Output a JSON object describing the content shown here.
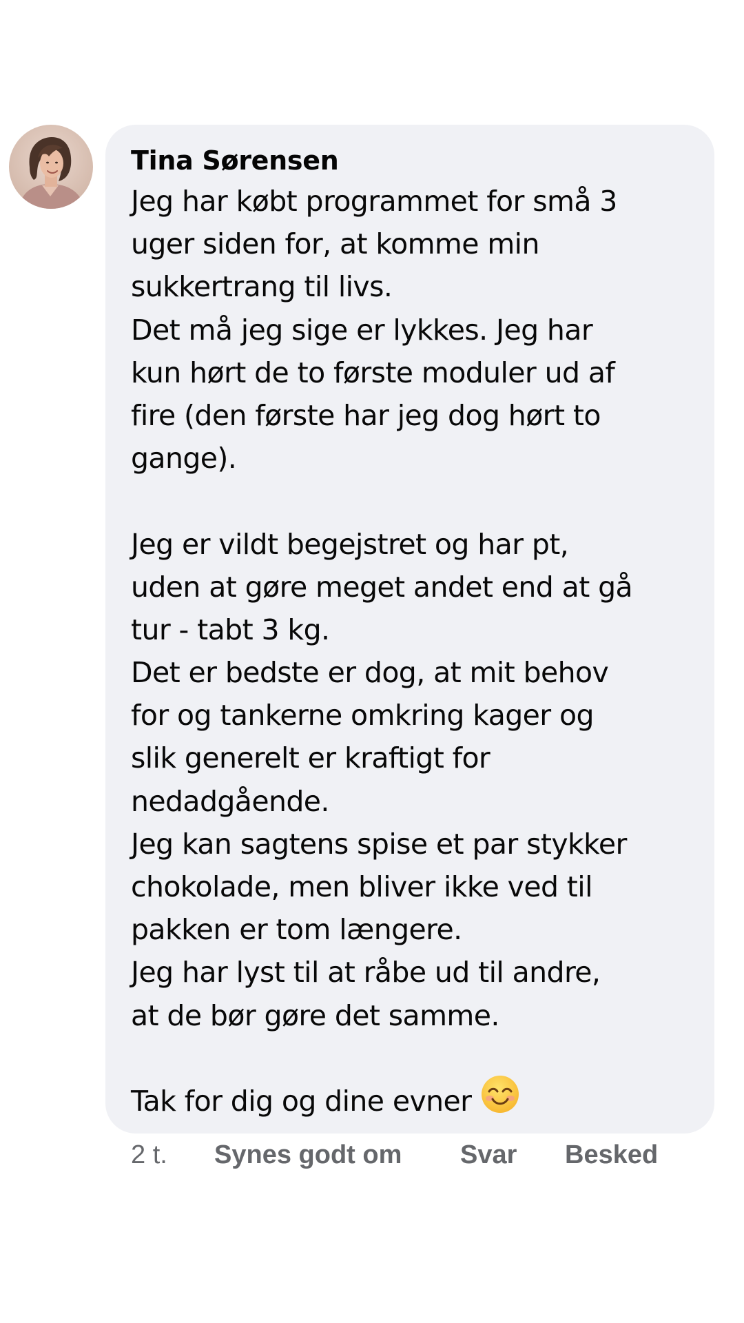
{
  "comment": {
    "author": "Tina Sørensen",
    "avatar_icon": "profile-photo",
    "lines": [
      "Jeg har købt programmet for små 3",
      "uger siden for, at komme min",
      "sukkertrang til livs.",
      "Det må jeg sige er lykkes. Jeg har",
      "kun hørt de to første moduler ud af",
      "fire (den første har jeg dog hørt to",
      "gange).",
      "",
      "Jeg er vildt begejstret og har pt,",
      "uden at gøre meget andet end at gå",
      "tur -  tabt 3 kg.",
      "Det er bedste er dog, at mit behov",
      "for og tankerne omkring kager og",
      "slik generelt er kraftigt for",
      "nedadgående.",
      "Jeg kan sagtens spise et par stykker",
      "chokolade, men bliver ikke ved til",
      "pakken er tom længere.",
      "Jeg har lyst til at råbe ud til andre,",
      "at de bør gøre det samme.",
      "",
      "Tak for dig og dine evner"
    ],
    "emoji": "smiling-face-with-smiling-eyes"
  },
  "actions": {
    "time": "2 t.",
    "like": "Synes godt om",
    "reply": "Svar",
    "message": "Besked"
  },
  "colors": {
    "bubble_bg": "#f0f1f5",
    "action_text": "#65676b",
    "text": "#050505"
  }
}
